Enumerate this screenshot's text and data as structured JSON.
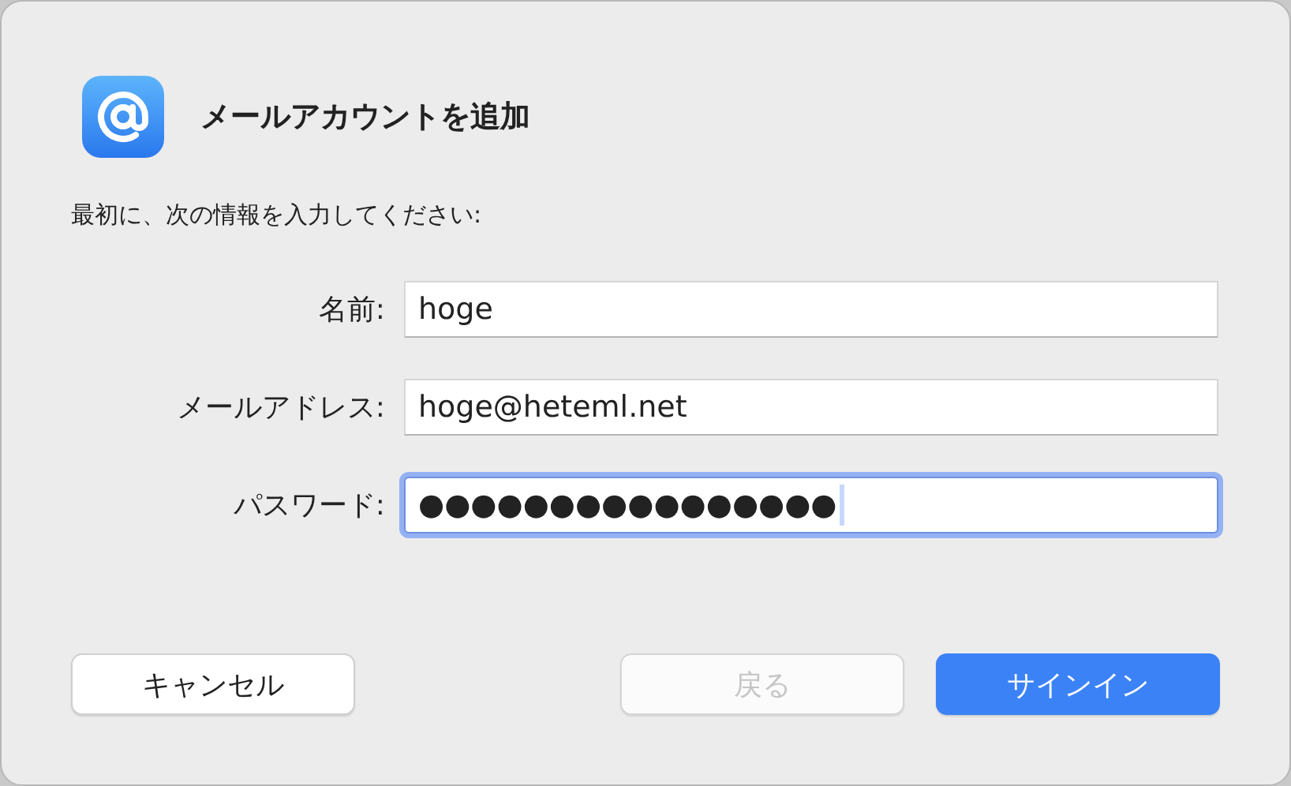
{
  "dialog": {
    "title": "メールアカウントを追加",
    "instruction": "最初に、次の情報を入力してください:"
  },
  "fields": [
    {
      "label": "名前:",
      "value": "hoge",
      "focused": false
    },
    {
      "label": "メールアドレス:",
      "value": "hoge@heteml.net",
      "focused": false
    },
    {
      "label": "パスワード:",
      "value": "●●●●●●●●●●●●●●●●",
      "focused": true
    }
  ],
  "buttons": [
    {
      "label": "キャンセル",
      "kind": "normal",
      "disabled": false
    },
    {
      "label": "戻る",
      "kind": "normal",
      "disabled": true
    },
    {
      "label": "サインイン",
      "kind": "primary",
      "disabled": false
    }
  ]
}
